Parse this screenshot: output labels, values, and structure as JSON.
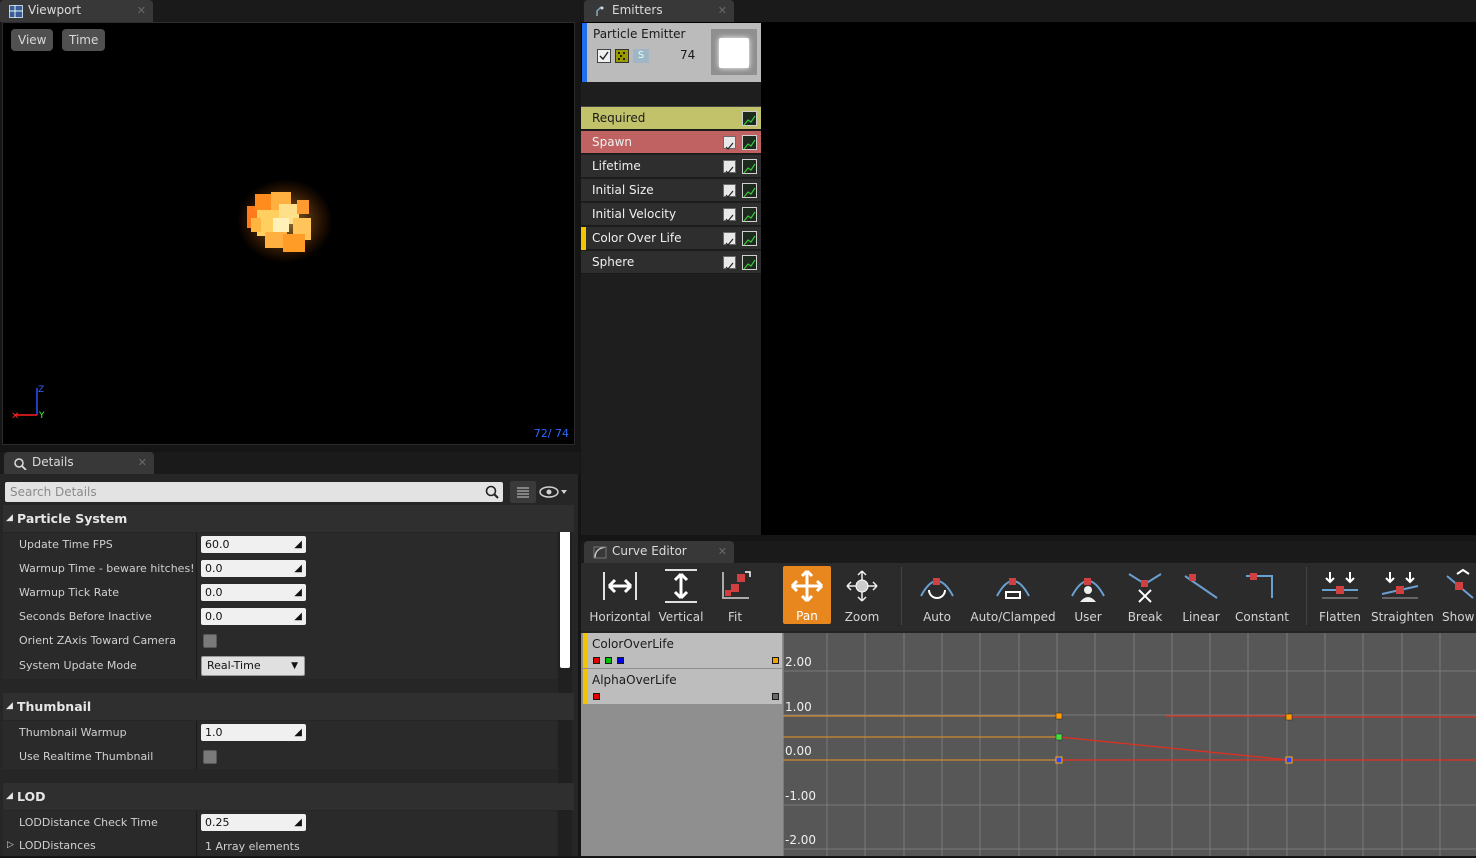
{
  "viewport": {
    "tab_title": "Viewport",
    "buttons": [
      "View",
      "Time"
    ],
    "particle_count": "72/  74",
    "axis_labels": {
      "z": "Z",
      "y": "Y"
    }
  },
  "details": {
    "tab_title": "Details",
    "search_placeholder": "Search Details",
    "sections": [
      {
        "title": "Particle System",
        "rows": [
          {
            "label": "Update Time FPS",
            "type": "number",
            "value": "60.0"
          },
          {
            "label": "Warmup Time - beware hitches!",
            "type": "number",
            "value": "0.0"
          },
          {
            "label": "Warmup Tick Rate",
            "type": "number",
            "value": "0.0"
          },
          {
            "label": "Seconds Before Inactive",
            "type": "number",
            "value": "0.0"
          },
          {
            "label": "Orient ZAxis Toward Camera",
            "type": "checkbox",
            "value": false
          },
          {
            "label": "System Update Mode",
            "type": "dropdown",
            "value": "Real-Time"
          }
        ]
      },
      {
        "title": "Thumbnail",
        "rows": [
          {
            "label": "Thumbnail Warmup",
            "type": "number",
            "value": "1.0"
          },
          {
            "label": "Use Realtime Thumbnail",
            "type": "checkbox",
            "value": false
          }
        ]
      },
      {
        "title": "LOD",
        "rows": [
          {
            "label": "LODDistance Check Time",
            "type": "number",
            "value": "0.25"
          },
          {
            "label": "LODDistances",
            "type": "text",
            "value": "1 Array elements"
          }
        ]
      }
    ]
  },
  "emitters": {
    "tab_title": "Emitters",
    "emitter_name": "Particle Emitter",
    "emitter_count": "74",
    "emitter_letter": "S",
    "modules": [
      {
        "label": "Required",
        "bg": "#c2c26a",
        "text_color": "#1a1a1a",
        "has_checkbox": false,
        "marker": null
      },
      {
        "label": "Spawn",
        "bg": "#c06262",
        "text_color": "#f0f0f0",
        "has_checkbox": true,
        "marker": null
      },
      {
        "label": "Lifetime",
        "bg": "#2e2e2e",
        "text_color": "#f0f0f0",
        "has_checkbox": true,
        "marker": null
      },
      {
        "label": "Initial Size",
        "bg": "#2e2e2e",
        "text_color": "#f0f0f0",
        "has_checkbox": true,
        "marker": null
      },
      {
        "label": "Initial Velocity",
        "bg": "#2e2e2e",
        "text_color": "#f0f0f0",
        "has_checkbox": true,
        "marker": null
      },
      {
        "label": "Color Over Life",
        "bg": "#2e2e2e",
        "text_color": "#f0f0f0",
        "has_checkbox": true,
        "marker": "#f3c400"
      },
      {
        "label": "Sphere",
        "bg": "#2e2e2e",
        "text_color": "#f0f0f0",
        "has_checkbox": true,
        "marker": null
      }
    ]
  },
  "curve_editor": {
    "tab_title": "Curve Editor",
    "tools": [
      {
        "label": "Horizontal",
        "icon": "horizontal-fit-icon",
        "active": false
      },
      {
        "label": "Vertical",
        "icon": "vertical-fit-icon",
        "active": false
      },
      {
        "label": "Fit",
        "icon": "fit-icon",
        "active": false
      },
      {
        "label": "Pan",
        "icon": "pan-icon",
        "active": true
      },
      {
        "label": "Zoom",
        "icon": "zoom-icon",
        "active": false
      },
      {
        "label": "Auto",
        "icon": "auto-tangent-icon",
        "active": false
      },
      {
        "label": "Auto/Clamped",
        "icon": "auto-clamped-tangent-icon",
        "active": false
      },
      {
        "label": "User",
        "icon": "user-tangent-icon",
        "active": false
      },
      {
        "label": "Break",
        "icon": "break-tangent-icon",
        "active": false
      },
      {
        "label": "Linear",
        "icon": "linear-tangent-icon",
        "active": false
      },
      {
        "label": "Constant",
        "icon": "constant-tangent-icon",
        "active": false
      },
      {
        "label": "Flatten",
        "icon": "flatten-icon",
        "active": false
      },
      {
        "label": "Straighten",
        "icon": "straighten-icon",
        "active": false
      },
      {
        "label": "Show",
        "icon": "show-icon",
        "active": false
      }
    ],
    "tracks": [
      {
        "label": "ColorOverLife",
        "swatches": [
          "#e00000",
          "#00c000",
          "#0000e0"
        ],
        "end_swatch": "#f3a000"
      },
      {
        "label": "AlphaOverLife",
        "swatches": [
          "#e00000"
        ],
        "end_swatch": "#6a6a6a"
      }
    ],
    "y_labels": [
      "2.00",
      "1.00",
      "0.00",
      "-1.00",
      "-2.00"
    ]
  },
  "colors": {
    "accent_orange": "#e8871e",
    "track_yellow": "#f3c400",
    "emitter_blue": "#1e6ff0"
  }
}
